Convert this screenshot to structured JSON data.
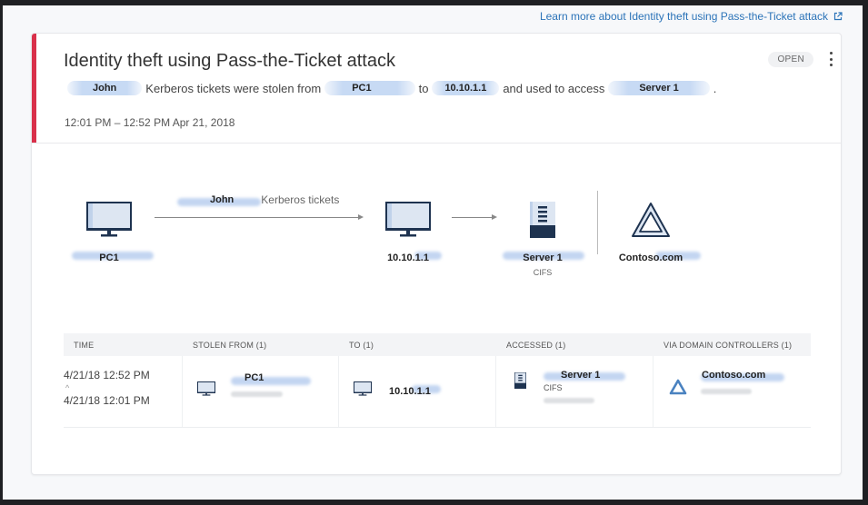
{
  "learn_more": {
    "label": "Learn more about Identity theft using Pass-the-Ticket attack",
    "icon": "external-link-icon"
  },
  "alert": {
    "title": "Identity theft using Pass-the-Ticket attack",
    "status": "OPEN",
    "severity_color": "#d9304a",
    "description": {
      "user": "John",
      "text1": "Kerberos tickets were stolen from",
      "source": "PC1",
      "text2": "to",
      "destination": "10.10.1.1",
      "text3": "and used to access",
      "resource": "Server 1",
      "end": "."
    },
    "time_range": "12:01 PM – 12:52 PM Apr 21, 2018"
  },
  "graph": {
    "edge_label_user": "John",
    "edge_label_text": "Kerberos tickets",
    "nodes": [
      {
        "id": "source",
        "label": "PC1",
        "icon": "monitor-icon"
      },
      {
        "id": "destination",
        "label": "10.10.1.1",
        "icon": "monitor-icon"
      },
      {
        "id": "resource",
        "label": "Server 1",
        "sub": "CIFS",
        "icon": "server-icon"
      },
      {
        "id": "domain",
        "label": "Contoso.com",
        "icon": "domain-controller-icon"
      }
    ]
  },
  "table": {
    "headers": [
      "TIME",
      "STOLEN FROM (1)",
      "TO (1)",
      "ACCESSED (1)",
      "VIA DOMAIN CONTROLLERS (1)"
    ],
    "row": {
      "time_end": "4/21/18 12:52 PM",
      "caret": "^",
      "time_start": "4/21/18 12:01 PM",
      "stolen_from": "PC1",
      "to": "10.10.1.1",
      "accessed": "Server 1",
      "accessed_sub": "CIFS",
      "via": "Contoso.com"
    }
  }
}
